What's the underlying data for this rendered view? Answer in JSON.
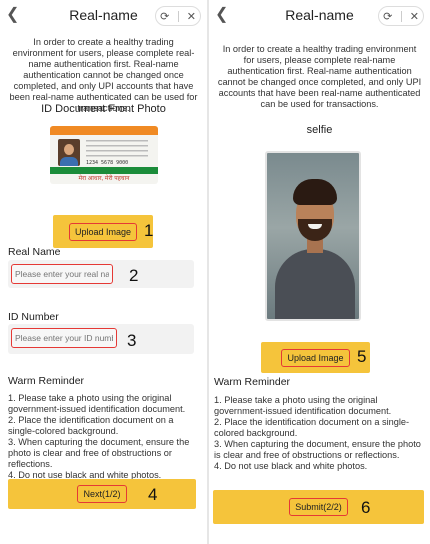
{
  "left": {
    "header": {
      "back_icon": "chevron-left-icon",
      "title": "Real-name",
      "refresh_icon": "refresh-icon",
      "close_icon": "close-icon"
    },
    "intro": "In order to create a healthy trading environment for users, please complete real-name authentication first. Real-name authentication cannot be changed once completed, and only UPI accounts that have been real-name authenticated can be used for transactions.",
    "section_title": "ID Document Front Photo",
    "id_card": {
      "number": "1234 5678 9000",
      "tagline": "मेरा आधार, मेरी पहचान"
    },
    "upload_button": "Upload Image",
    "real_name": {
      "label": "Real Name",
      "placeholder": "Please enter your real name",
      "value": ""
    },
    "id_number": {
      "label": "ID Number",
      "placeholder": "Please enter your ID number",
      "value": ""
    },
    "reminder": {
      "title": "Warm Reminder",
      "items": [
        "1. Please take a photo using the original government-issued identification document.",
        "2. Place the identification document on a single-colored background.",
        "3. When capturing the document, ensure the photo is clear and free of obstructions or reflections.",
        "4. Do not use black and white photos."
      ]
    },
    "next_button": "Next(1/2)",
    "markers": {
      "m1": "1",
      "m2": "2",
      "m3": "3",
      "m4": "4"
    }
  },
  "right": {
    "header": {
      "back_icon": "chevron-left-icon",
      "title": "Real-name",
      "refresh_icon": "refresh-icon",
      "close_icon": "close-icon"
    },
    "intro": "In order to create a healthy trading environment for users, please complete real-name authentication first. Real-name authentication cannot be changed once completed, and only UPI accounts that have been real-name authenticated can be used for transactions.",
    "section_title": "selfie",
    "upload_button": "Upload Image",
    "reminder": {
      "title": "Warm Reminder",
      "items": [
        "1. Please take a photo using the original government-issued identification document.",
        "2. Place the identification document on a single-colored background.",
        "3. When capturing the document, ensure the photo is clear and free of obstructions or reflections.",
        "4. Do not use black and white photos."
      ]
    },
    "submit_button": "Submit(2/2)",
    "markers": {
      "m5": "5",
      "m6": "6"
    }
  },
  "colors": {
    "accent": "#f5c43b",
    "highlight": "#e53935"
  }
}
